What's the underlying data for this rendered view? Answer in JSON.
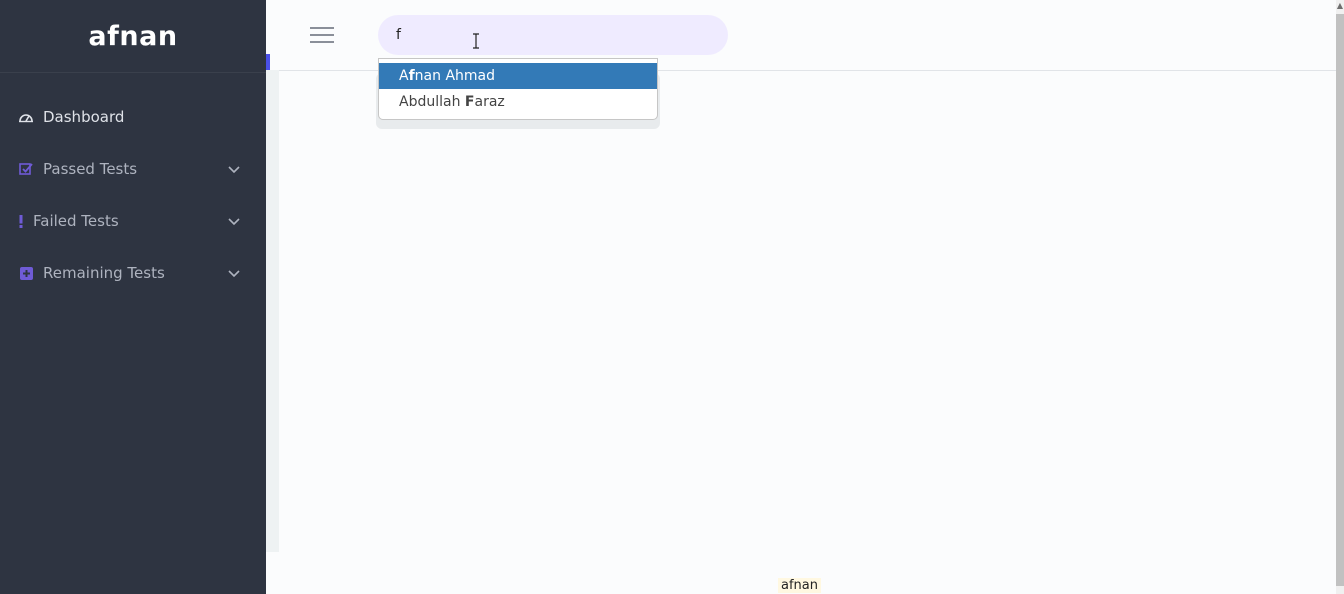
{
  "sidebar": {
    "brand": "afnan",
    "items": [
      {
        "label": "Dashboard",
        "icon": "dashboard-gauge-icon"
      },
      {
        "label": "Passed Tests",
        "icon": "checkbox-check-icon"
      },
      {
        "label": "Failed Tests",
        "icon": "exclamation-icon"
      },
      {
        "label": "Remaining Tests",
        "icon": "plus-square-icon"
      }
    ]
  },
  "search": {
    "value": "f",
    "suggestions": [
      {
        "pre": "A",
        "match": "f",
        "post": "nan Ahmad",
        "selected": true
      },
      {
        "pre": "Abdullah ",
        "match": "F",
        "post": "araz",
        "selected": false
      }
    ]
  },
  "footer": {
    "text": "afnan"
  },
  "colors": {
    "sidebar_bg": "#2e3441",
    "accent": "#4a50e8",
    "icon_accent": "#6f5bd6",
    "search_bg": "#efebff",
    "selected_bg": "#337ab7"
  }
}
